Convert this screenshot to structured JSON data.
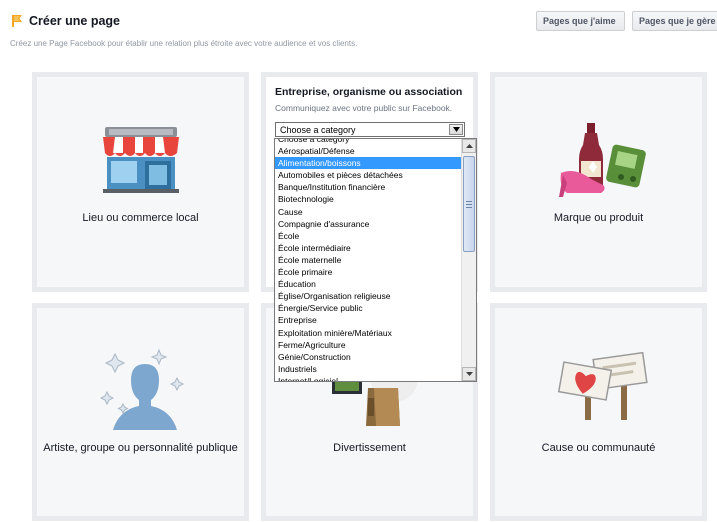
{
  "header": {
    "title": "Créer une page",
    "subtitle": "Créez une Page Facebook pour établir une relation plus étroite avec votre audience et vos clients.",
    "buttons": {
      "liked": "Pages que j'aime",
      "admin": "Pages que je gère"
    }
  },
  "tiles": {
    "local": "Lieu ou commerce local",
    "company": {
      "title": "Entreprise, organisme ou association",
      "description": "Communiquez avec votre public sur Facebook.",
      "select_value": "Choose a category"
    },
    "brand": "Marque ou produit",
    "artist": "Artiste, groupe ou personnalité publique",
    "entertainment": "Divertissement",
    "cause": "Cause ou communauté"
  },
  "dropdown": {
    "items": [
      "Choose a category",
      "Aérospatial/Défense",
      "Alimentation/boissons",
      "Automobiles et pièces détachées",
      "Banque/Institution financière",
      "Biotechnologie",
      "Cause",
      "Compagnie d'assurance",
      "École",
      "École intermédiaire",
      "École maternelle",
      "École primaire",
      "Éducation",
      "Église/Organisation religieuse",
      "Énergie/Service public",
      "Entreprise",
      "Exploitation minière/Matériaux",
      "Ferme/Agriculture",
      "Génie/Construction",
      "Industriels",
      "Internet/Logiciel"
    ],
    "selected_index": 2
  },
  "colors": {
    "selection": "#3399ff",
    "tile_border": "#e9eaed",
    "tile_bg": "#f6f7f9"
  }
}
